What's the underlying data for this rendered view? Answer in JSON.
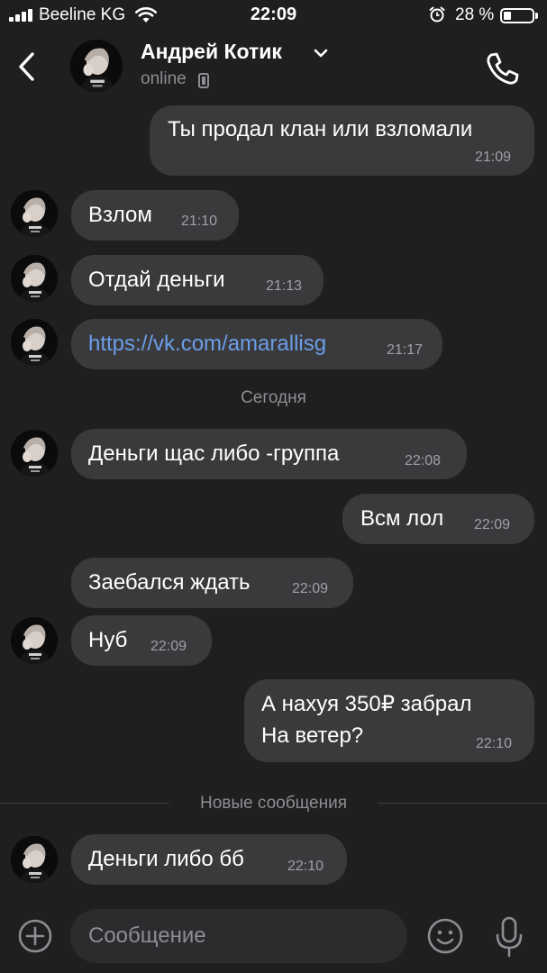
{
  "status_bar": {
    "carrier": "Beeline KG",
    "time": "22:09",
    "battery_percent_text": "28 %",
    "battery_level": 0.28
  },
  "header": {
    "contact_name": "Андрей Котик",
    "status": "online",
    "icons": [
      "back-arrow-icon",
      "chevron-down-icon",
      "mobile-phone-icon",
      "phone-call-icon"
    ]
  },
  "messages": [
    {
      "direction": "out",
      "text": "Ты продал клан или взломали",
      "time": "21:09"
    },
    {
      "direction": "in",
      "text": "Взлом",
      "time": "21:10"
    },
    {
      "direction": "in",
      "text": "Отдай деньги",
      "time": "21:13"
    },
    {
      "direction": "in",
      "text": "https://vk.com/amarallisg",
      "time": "21:17",
      "is_link": true
    },
    {
      "direction": "in",
      "text": "Деньги щас либо -группа",
      "time": "22:08"
    },
    {
      "direction": "out",
      "text": "Всм лол",
      "time": "22:09"
    },
    {
      "direction": "in",
      "text": "Заебался ждать",
      "time": "22:09"
    },
    {
      "direction": "in",
      "text": "Нуб",
      "time": "22:09"
    },
    {
      "direction": "out",
      "text": "А нахуя 350₽ забрал\nНа ветер?",
      "time": "22:10"
    },
    {
      "direction": "in",
      "text": "Деньги либо бб",
      "time": "22:10"
    }
  ],
  "date_separator": "Сегодня",
  "new_messages_label": "Новые сообщения",
  "composer": {
    "placeholder": "Сообщение",
    "icons": [
      "plus-circle-icon",
      "emoji-icon",
      "microphone-icon"
    ]
  },
  "colors": {
    "background": "#1f1f20",
    "bubble": "#3a3a3c",
    "link": "#6b9ee8",
    "secondary_text": "#8d8e93"
  }
}
